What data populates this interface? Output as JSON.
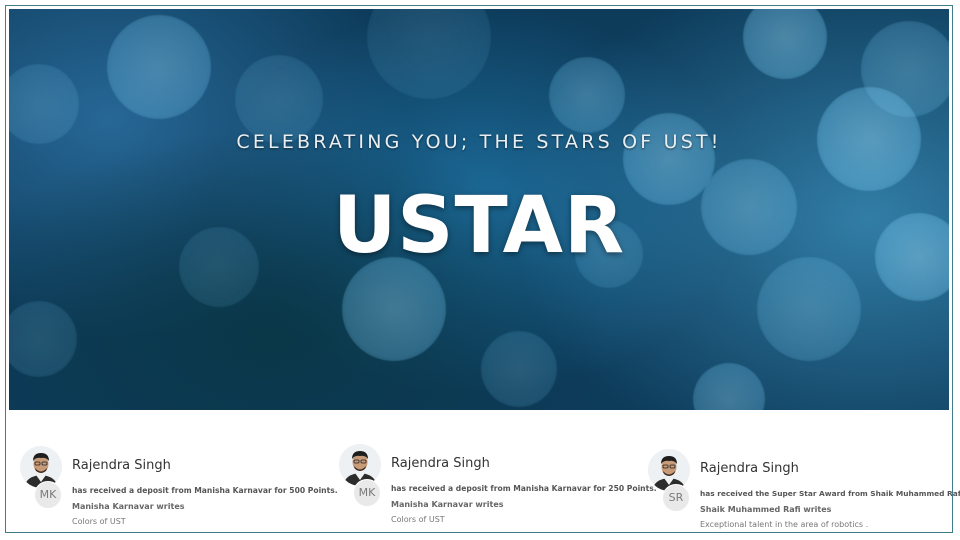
{
  "hero": {
    "subtitle": "CELEBRATING YOU; THE STARS OF UST!",
    "title": "USTAR"
  },
  "feed": [
    {
      "recipient": "Rajendra Singh",
      "giver_initials": "MK",
      "action": "has received a deposit from Manisha Karnavar for 500 Points.",
      "writer": "Manisha Karnavar writes",
      "message": "Colors of UST"
    },
    {
      "recipient": "Rajendra Singh",
      "giver_initials": "MK",
      "action": "has received a deposit from Manisha Karnavar for 250 Points.",
      "writer": "Manisha Karnavar writes",
      "message": "Colors of UST"
    },
    {
      "recipient": "Rajendra Singh",
      "giver_initials": "SR",
      "action": "has received the Super Star Award from Shaik Muhammed Rafi.",
      "writer": "Shaik Muhammed Rafi writes",
      "message": "Exceptional talent in the area of robotics ."
    }
  ],
  "colors": {
    "hero_dark": "#0a2d45",
    "hero_mid": "#1c6a98",
    "frame_border": "#3f7d8a"
  }
}
